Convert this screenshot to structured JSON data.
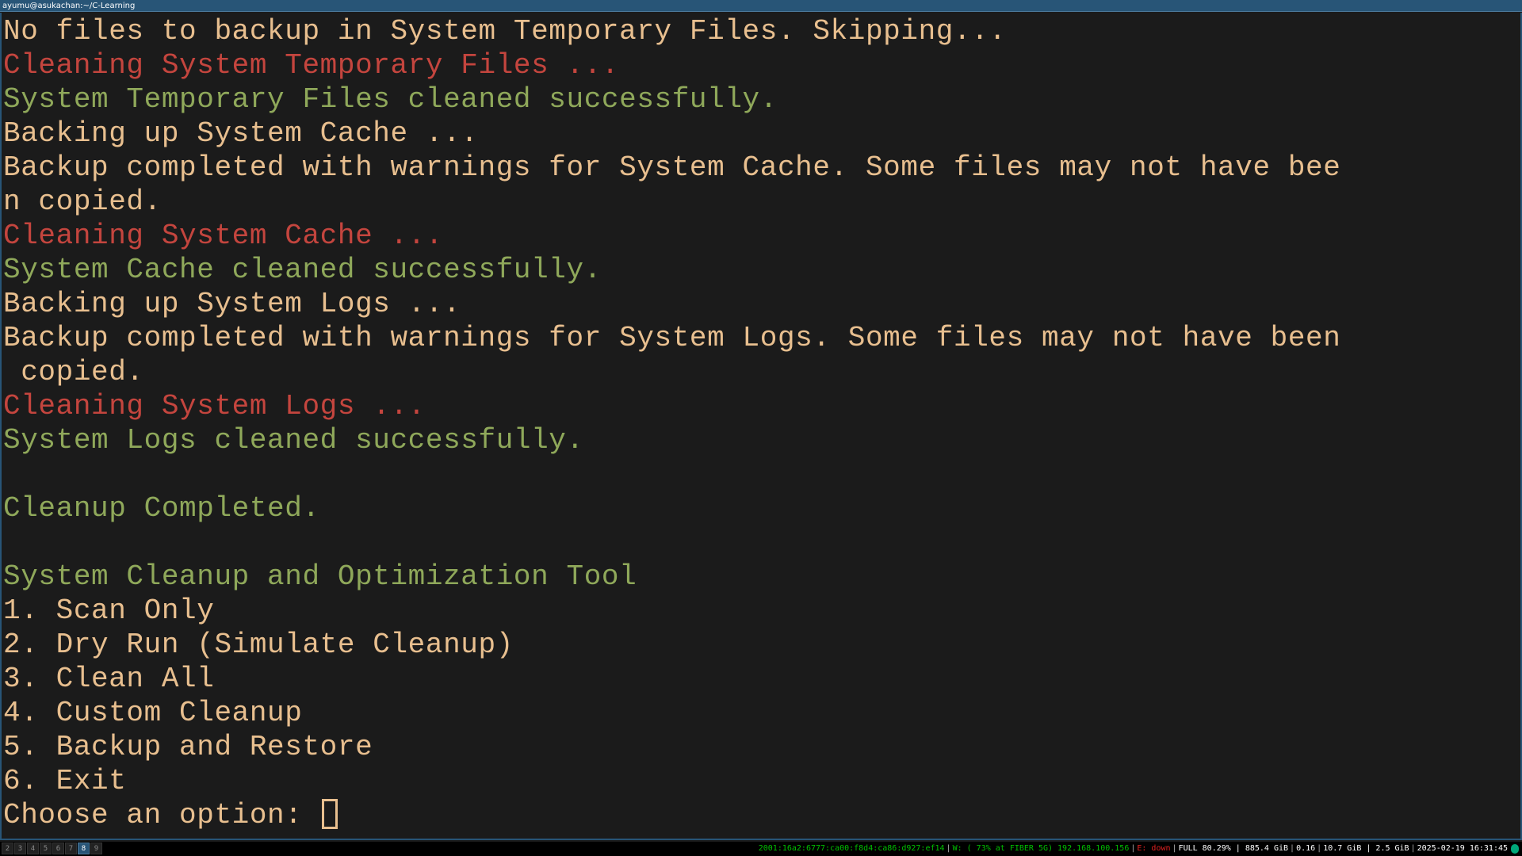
{
  "window": {
    "title": "ayumu@asukachan:~/C-Learning"
  },
  "colors": {
    "background": "#1b1b1b",
    "default_text": "#e8bf8f",
    "red_text": "#c4453e",
    "green_text": "#8fa85a",
    "title_bar": "#285577"
  },
  "terminal": {
    "lines": [
      {
        "text": "No files to backup in System Temporary Files. Skipping...",
        "color": "fg"
      },
      {
        "text": "Cleaning System Temporary Files ...",
        "color": "red"
      },
      {
        "text": "System Temporary Files cleaned successfully.",
        "color": "green"
      },
      {
        "text": "Backing up System Cache ...",
        "color": "fg"
      },
      {
        "text": "Backup completed with warnings for System Cache. Some files may not have bee",
        "color": "fg"
      },
      {
        "text": "n copied.",
        "color": "fg"
      },
      {
        "text": "Cleaning System Cache ...",
        "color": "red"
      },
      {
        "text": "System Cache cleaned successfully.",
        "color": "green"
      },
      {
        "text": "Backing up System Logs ...",
        "color": "fg"
      },
      {
        "text": "Backup completed with warnings for System Logs. Some files may not have been",
        "color": "fg"
      },
      {
        "text": " copied.",
        "color": "fg"
      },
      {
        "text": "Cleaning System Logs ...",
        "color": "red"
      },
      {
        "text": "System Logs cleaned successfully.",
        "color": "green"
      },
      {
        "text": "",
        "color": "fg"
      },
      {
        "text": "Cleanup Completed.",
        "color": "green"
      },
      {
        "text": "",
        "color": "fg"
      },
      {
        "text": "System Cleanup and Optimization Tool",
        "color": "green"
      },
      {
        "text": "1. Scan Only",
        "color": "fg"
      },
      {
        "text": "2. Dry Run (Simulate Cleanup)",
        "color": "fg"
      },
      {
        "text": "3. Clean All",
        "color": "fg"
      },
      {
        "text": "4. Custom Cleanup",
        "color": "fg"
      },
      {
        "text": "5. Backup and Restore",
        "color": "fg"
      },
      {
        "text": "6. Exit",
        "color": "fg"
      }
    ],
    "prompt": "Choose an option: "
  },
  "statusbar": {
    "workspaces": [
      "2",
      "3",
      "4",
      "5",
      "6",
      "7",
      "8",
      "9"
    ],
    "active_workspace": "8",
    "ipv6": "2001:16a2:6777:ca00:f8d4:ca86:d927:ef14",
    "wireless": "W: ( 73% at FIBER 5G) 192.168.100.156",
    "ethernet": "E: down",
    "disk": "FULL 80.29% | 885.4 GiB",
    "load": "0.16",
    "memory": "10.7 GiB | 2.5 GiB",
    "datetime": "2025-02-19 16:31:45"
  }
}
